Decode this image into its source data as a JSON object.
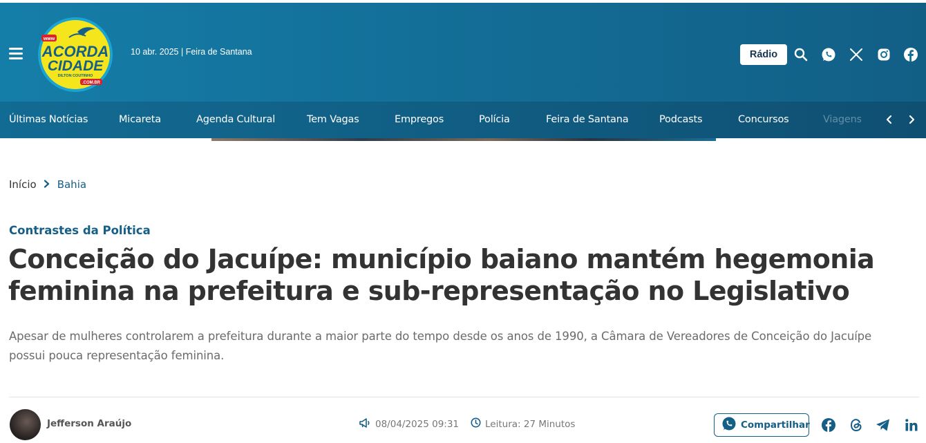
{
  "header": {
    "menu_icon": "hamburger-icon",
    "logo": {
      "line1": "ACORDA",
      "line2": "CIDADE",
      "www": "www",
      "subline": "DILTON COUTINHO",
      "domain": ".COM.BR"
    },
    "dateline": "10 abr. 2025 | Feira de Santana",
    "radio_label": "Rádio",
    "icons": [
      "search-icon",
      "whatsapp-icon",
      "x-icon",
      "instagram-icon",
      "facebook-icon"
    ]
  },
  "nav": {
    "items": [
      "Últimas Notícias",
      "Micareta",
      "Agenda Cultural",
      "Tem Vagas",
      "Empregos",
      "Polícia",
      "Feira de Santana",
      "Podcasts",
      "Concursos",
      "Viagens"
    ],
    "prev_icon": "chevron-left-icon",
    "next_icon": "chevron-right-icon"
  },
  "breadcrumb": {
    "home": "Início",
    "separator_icon": "chevron-right-icon",
    "current": "Bahia"
  },
  "article": {
    "kicker": "Contrastes da Política",
    "headline": "Conceição do Jacuípe: município baiano mantém hegemonia feminina na prefeitura e sub-representação no Legislativo",
    "subtitle": "Apesar de mulheres controlarem a prefeitura durante a maior parte do tempo desde os anos de 1990, a Câmara de Vereadores de Conceição do Jacuípe possui pouca representação feminina.",
    "author": "Jefferson Araújo",
    "published": "08/04/2025 09:31",
    "reading_time": "Leitura: 27 Minutos"
  },
  "share": {
    "label": "Compartilhar",
    "icons": [
      "facebook-icon",
      "threads-icon",
      "telegram-icon",
      "linkedin-icon"
    ]
  },
  "colors": {
    "header_bg": "#136f98",
    "accent": "#155e86",
    "logo_yellow": "#f4e51c",
    "logo_red": "#d8232a"
  }
}
